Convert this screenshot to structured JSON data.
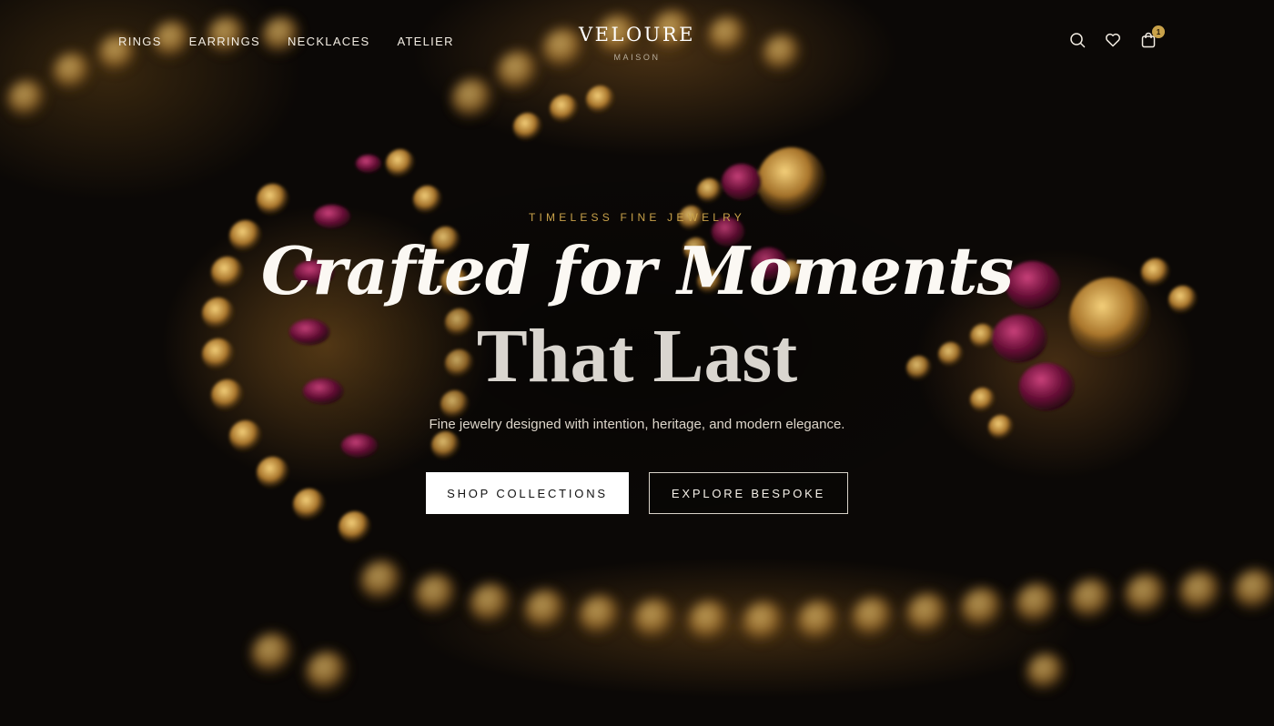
{
  "nav": {
    "links": [
      "RINGS",
      "EARRINGS",
      "NECKLACES",
      "ATELIER"
    ],
    "icons": [
      "search-icon",
      "heart-icon",
      "shopping-bag-icon"
    ],
    "cart_count": "1"
  },
  "brand": {
    "name": "VELOURE",
    "sub": "MAISON"
  },
  "hero": {
    "eyebrow": "TIMELESS FINE JEWELRY",
    "headline_script": "Crafted for Moments",
    "headline_serif": "That Last",
    "subhead": "Fine jewelry designed with intention, heritage, and modern elegance.",
    "primary_cta": "SHOP COLLECTIONS",
    "secondary_cta": "EXPLORE BESPOKE"
  },
  "colors": {
    "accent_gold": "#c9a24a",
    "background": "#0b0806",
    "button_fill": "#ffffff"
  }
}
